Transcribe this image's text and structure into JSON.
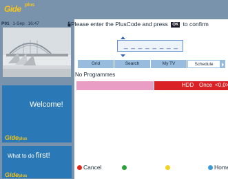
{
  "header": {
    "logo_text": "Gide",
    "logo_plus": "plus"
  },
  "status": {
    "channel": "P01",
    "date": "1-Sep",
    "time": "16:47"
  },
  "prompt": {
    "before": "Please enter the PlusCode and press",
    "ok_key": "OK",
    "after": "to confirm"
  },
  "code_entry": {
    "value": "_ _ _ _ _ _ _ _"
  },
  "tabs": [
    {
      "label": "Grid",
      "selected": false
    },
    {
      "label": "Search",
      "selected": false
    },
    {
      "label": "My TV",
      "selected": false
    },
    {
      "label": "Schedule",
      "selected": true
    }
  ],
  "schedule": {
    "empty_label": "No Programmes",
    "entry": {
      "device": "HDD",
      "frequency": "Once",
      "count": "<0,0>"
    }
  },
  "panels": {
    "welcome": "Welcome!",
    "what_prefix": "What to do",
    "what_word": "first!"
  },
  "legend": {
    "red": "Cancel",
    "blue": "Home"
  },
  "colors": {
    "background": "#7a93ad",
    "logo": "#f5c51a",
    "tab": "#98bcdd",
    "record_red": "#da2125",
    "record_pink": "#e99dc4",
    "red_key": "#e3271e",
    "green_key": "#29a03a",
    "yellow_key": "#f2d21a",
    "blue_key": "#3c9ad9"
  }
}
